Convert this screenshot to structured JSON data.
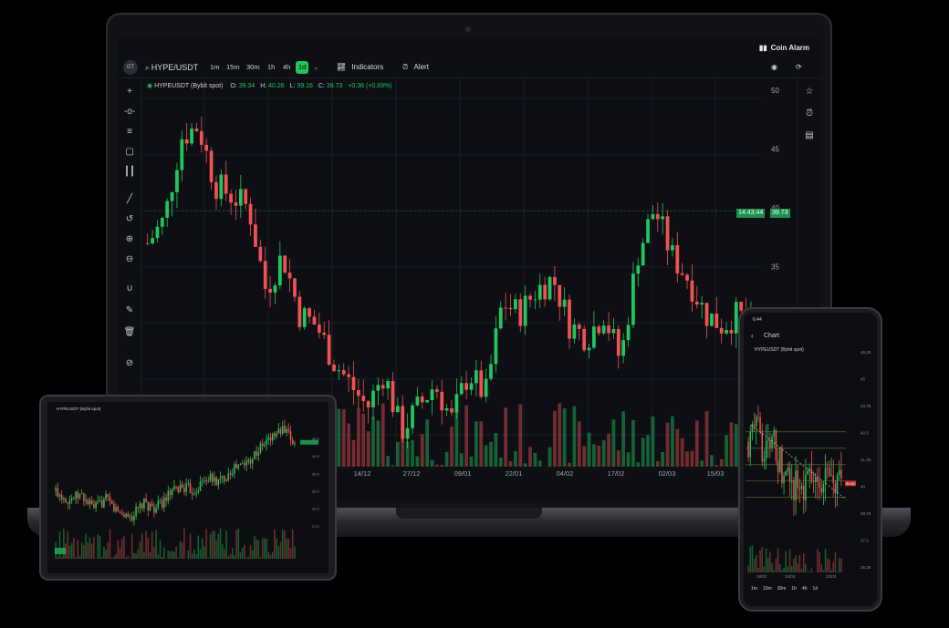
{
  "menubar": {
    "app_name": "Coin Alarm"
  },
  "toolbar": {
    "avatar": "GT",
    "symbol": "HYPE/USDT",
    "timeframes": [
      "1m",
      "15m",
      "30m",
      "1h",
      "4h",
      "1d"
    ],
    "active_timeframe": "1d",
    "indicators_label": "Indicators",
    "alert_label": "Alert"
  },
  "legend": {
    "title": "HYPEUSDT (Bybit spot)",
    "o_label": "O:",
    "o": "39.34",
    "h_label": "H:",
    "h": "40.26",
    "l_label": "L:",
    "l": "39.16",
    "c_label": "C:",
    "c": "39.73",
    "change": "+0.38 (+0.69%)"
  },
  "price_tag": {
    "timer": "14:43:44",
    "price": "39.73"
  },
  "colors": {
    "up": "#22c55e",
    "down": "#f05252",
    "accent": "#22c55e"
  },
  "chart_data": {
    "type": "candlestick",
    "title": "HYPEUSDT (Bybit spot)",
    "y_ticks": [
      "50",
      "45",
      "40",
      "35"
    ],
    "x_ticks": [
      "14/12",
      "27/12",
      "09/01",
      "22/01",
      "04/02",
      "17/02",
      "02/03",
      "15/03"
    ],
    "ylim": [
      18,
      51
    ],
    "close_path": [
      37,
      39,
      46,
      47,
      42,
      41,
      40,
      33,
      36,
      31,
      30,
      27,
      25,
      23,
      26,
      21,
      23,
      25,
      22,
      26,
      24,
      32,
      31,
      33,
      34,
      30,
      29,
      31,
      27,
      36,
      40,
      36,
      34,
      31,
      30,
      31,
      29
    ]
  },
  "tablet": {
    "title": "HYPEUSDT (Bybit spot)"
  },
  "phone": {
    "time": "6:44",
    "header": "Chart",
    "legend": "HYPEUSDT (Bybit spot)",
    "y_ticks": [
      "46.25",
      "45",
      "43.75",
      "42.5",
      "41.25",
      "40",
      "38.75",
      "37.5",
      "36.25"
    ],
    "x_ticks": [
      "18/02",
      "15/03",
      "22/03"
    ],
    "timeframes": [
      "1m",
      "15m",
      "30m",
      "1h",
      "4h",
      "1d"
    ],
    "price": "39.82"
  }
}
